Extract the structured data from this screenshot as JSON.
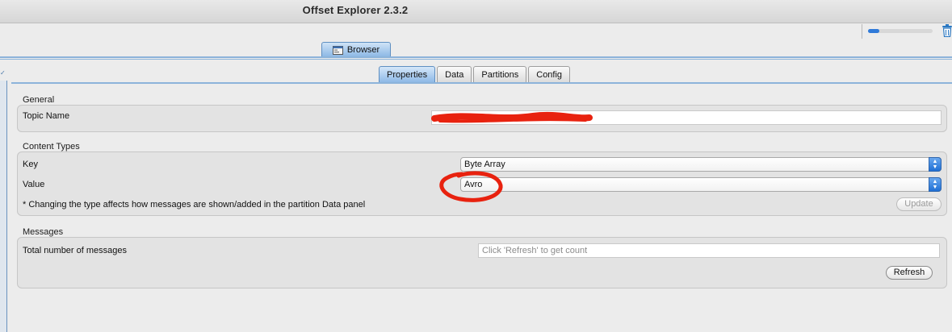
{
  "window": {
    "title": "Offset Explorer  2.3.2"
  },
  "toolbar": {
    "progress_fraction": 0.18,
    "trash_icon": "trash-icon"
  },
  "browser_tab": {
    "label": "Browser",
    "icon": "window-tab-icon"
  },
  "tabs": [
    {
      "label": "Properties",
      "active": true
    },
    {
      "label": "Data",
      "active": false
    },
    {
      "label": "Partitions",
      "active": false
    },
    {
      "label": "Config",
      "active": false
    }
  ],
  "general": {
    "title": "General",
    "topic_name_label": "Topic Name"
  },
  "content_types": {
    "title": "Content Types",
    "key_label": "Key",
    "key_value": "Byte Array",
    "value_label": "Value",
    "value_value": "Avro",
    "hint": "* Changing the type affects how messages are shown/added in the partition Data panel",
    "update_label": "Update"
  },
  "messages": {
    "title": "Messages",
    "total_label": "Total number of messages",
    "count_placeholder": "Click 'Refresh' to get count",
    "refresh_label": "Refresh"
  },
  "colors": {
    "accent": "#2f7ad9",
    "annotation": "#e8220f"
  }
}
